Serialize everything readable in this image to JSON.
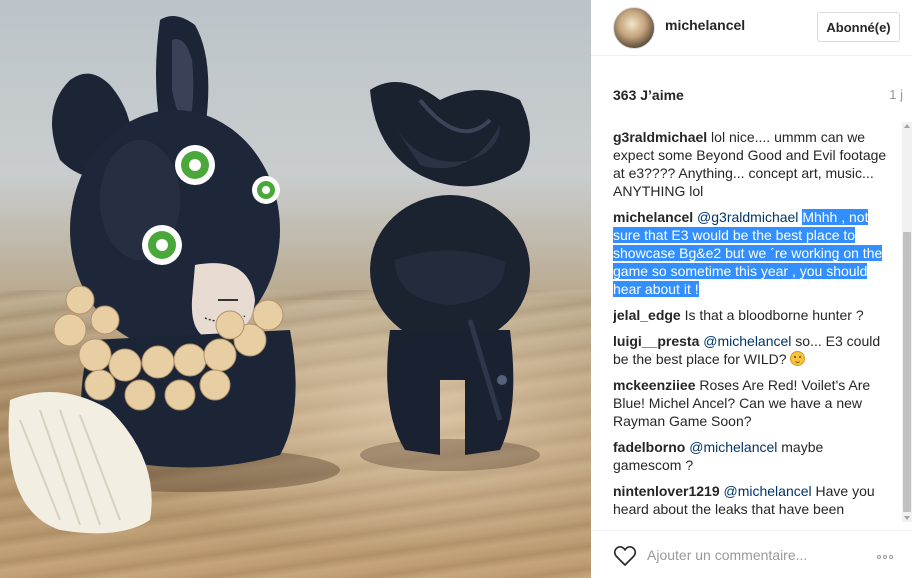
{
  "post": {
    "username": "michelancel",
    "follow_label": "Abonné(e)",
    "likes": "363 J’aime",
    "time": "1 j"
  },
  "comments": [
    {
      "user": "g3raldmichael",
      "segments": [
        {
          "t": "lol nice.... ummm can we expect some Beyond Good and Evil footage at e3???? Anything... concept art, music... ANYTHING lol",
          "k": "text"
        }
      ]
    },
    {
      "user": "michelancel",
      "segments": [
        {
          "t": "@g3raldmichael",
          "k": "mention"
        },
        {
          "t": " ",
          "k": "text"
        },
        {
          "t": "Mhhh , not sure that E3 would be the best place to showcase Bg&e2 but we ´re working on the game so sometime this year , you should hear about it !",
          "k": "sel"
        }
      ]
    },
    {
      "user": "jelal_edge",
      "segments": [
        {
          "t": "Is that a bloodborne hunter ?",
          "k": "text"
        }
      ]
    },
    {
      "user": "luigi__presta",
      "segments": [
        {
          "t": "@michelancel",
          "k": "mention"
        },
        {
          "t": " so... E3 could be the best place for WILD? ",
          "k": "text"
        },
        {
          "t": "smiling-face-emoji",
          "k": "emoji"
        }
      ]
    },
    {
      "user": "mckeenziiee",
      "segments": [
        {
          "t": "Roses Are Red! Voilet's Are Blue! Michel Ancel? Can we have a new Rayman Game Soon?",
          "k": "text"
        }
      ]
    },
    {
      "user": "fadelborno",
      "segments": [
        {
          "t": "@michelancel",
          "k": "mention"
        },
        {
          "t": " maybe gamescom ?",
          "k": "text"
        }
      ]
    },
    {
      "user": "nintenlover1219",
      "segments": [
        {
          "t": "@michelancel",
          "k": "mention"
        },
        {
          "t": " Have you heard about the leaks that have been happening to the game recently",
          "k": "text"
        }
      ]
    }
  ],
  "add_comment": {
    "placeholder": "Ajouter un commentaire..."
  },
  "icons": {
    "like": "heart-icon",
    "more": "more-options-icon"
  },
  "colors": {
    "mention": "#003569",
    "selection": "#338fff",
    "muted": "#999999"
  }
}
